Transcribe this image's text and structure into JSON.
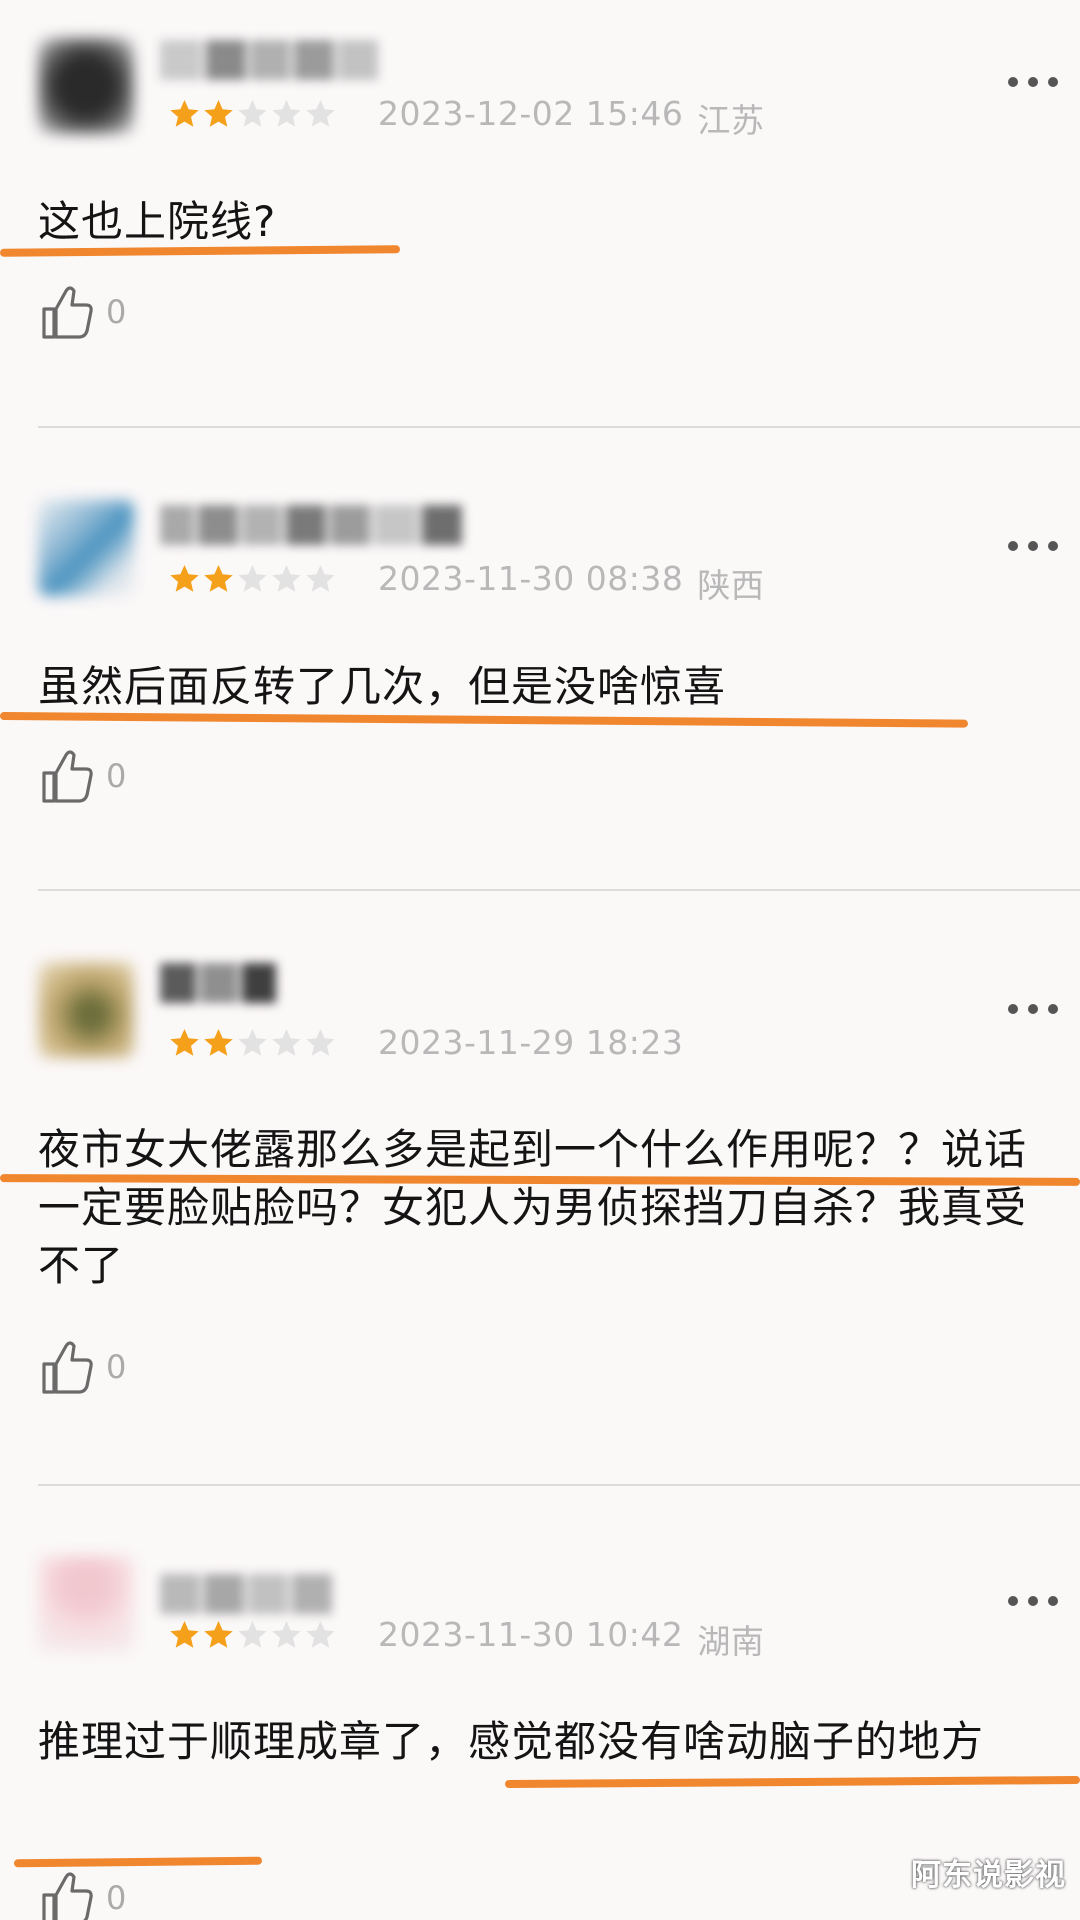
{
  "comments": [
    {
      "rating": 2,
      "rating_max": 5,
      "date": "2023-12-02 15:46",
      "location": "江苏",
      "text": "这也上院线?",
      "likes": "0"
    },
    {
      "rating": 2,
      "rating_max": 5,
      "date": "2023-11-30 08:38",
      "location": "陕西",
      "text": "虽然后面反转了几次，但是没啥惊喜",
      "likes": "0"
    },
    {
      "rating": 2,
      "rating_max": 5,
      "date": "2023-11-29 18:23",
      "location": "",
      "text": "夜市女大佬露那么多是起到一个什么作用呢？？说话一定要脸贴脸吗？女犯人为男侦探挡刀自杀？我真受不了",
      "likes": "0"
    },
    {
      "rating": 2,
      "rating_max": 5,
      "date": "2023-11-30 10:42",
      "location": "湖南",
      "text": "推理过于顺理成章了，感觉都没有啥动脑子的地方",
      "likes": "0"
    }
  ],
  "colors": {
    "star_filled": "#f5a01a",
    "star_empty": "#e2e2e2",
    "highlight": "#f0862d",
    "meta_text": "#b8b8b8"
  },
  "icons": [
    "more-dots-icon",
    "thumbs-up-icon",
    "star-icon"
  ],
  "watermark": "阿东说影视"
}
